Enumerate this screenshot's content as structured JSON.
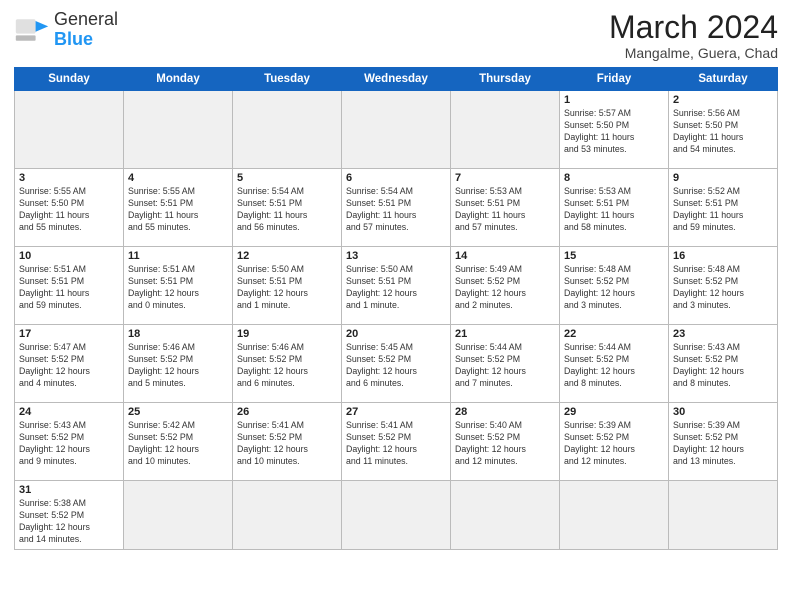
{
  "header": {
    "logo_general": "General",
    "logo_blue": "Blue",
    "month_title": "March 2024",
    "subtitle": "Mangalme, Guera, Chad"
  },
  "weekdays": [
    "Sunday",
    "Monday",
    "Tuesday",
    "Wednesday",
    "Thursday",
    "Friday",
    "Saturday"
  ],
  "weeks": [
    [
      {
        "day": "",
        "info": "",
        "empty": true
      },
      {
        "day": "",
        "info": "",
        "empty": true
      },
      {
        "day": "",
        "info": "",
        "empty": true
      },
      {
        "day": "",
        "info": "",
        "empty": true
      },
      {
        "day": "",
        "info": "",
        "empty": true
      },
      {
        "day": "1",
        "info": "Sunrise: 5:57 AM\nSunset: 5:50 PM\nDaylight: 11 hours\nand 53 minutes."
      },
      {
        "day": "2",
        "info": "Sunrise: 5:56 AM\nSunset: 5:50 PM\nDaylight: 11 hours\nand 54 minutes."
      }
    ],
    [
      {
        "day": "3",
        "info": "Sunrise: 5:55 AM\nSunset: 5:50 PM\nDaylight: 11 hours\nand 55 minutes."
      },
      {
        "day": "4",
        "info": "Sunrise: 5:55 AM\nSunset: 5:51 PM\nDaylight: 11 hours\nand 55 minutes."
      },
      {
        "day": "5",
        "info": "Sunrise: 5:54 AM\nSunset: 5:51 PM\nDaylight: 11 hours\nand 56 minutes."
      },
      {
        "day": "6",
        "info": "Sunrise: 5:54 AM\nSunset: 5:51 PM\nDaylight: 11 hours\nand 57 minutes."
      },
      {
        "day": "7",
        "info": "Sunrise: 5:53 AM\nSunset: 5:51 PM\nDaylight: 11 hours\nand 57 minutes."
      },
      {
        "day": "8",
        "info": "Sunrise: 5:53 AM\nSunset: 5:51 PM\nDaylight: 11 hours\nand 58 minutes."
      },
      {
        "day": "9",
        "info": "Sunrise: 5:52 AM\nSunset: 5:51 PM\nDaylight: 11 hours\nand 59 minutes."
      }
    ],
    [
      {
        "day": "10",
        "info": "Sunrise: 5:51 AM\nSunset: 5:51 PM\nDaylight: 11 hours\nand 59 minutes."
      },
      {
        "day": "11",
        "info": "Sunrise: 5:51 AM\nSunset: 5:51 PM\nDaylight: 12 hours\nand 0 minutes."
      },
      {
        "day": "12",
        "info": "Sunrise: 5:50 AM\nSunset: 5:51 PM\nDaylight: 12 hours\nand 1 minute."
      },
      {
        "day": "13",
        "info": "Sunrise: 5:50 AM\nSunset: 5:51 PM\nDaylight: 12 hours\nand 1 minute."
      },
      {
        "day": "14",
        "info": "Sunrise: 5:49 AM\nSunset: 5:52 PM\nDaylight: 12 hours\nand 2 minutes."
      },
      {
        "day": "15",
        "info": "Sunrise: 5:48 AM\nSunset: 5:52 PM\nDaylight: 12 hours\nand 3 minutes."
      },
      {
        "day": "16",
        "info": "Sunrise: 5:48 AM\nSunset: 5:52 PM\nDaylight: 12 hours\nand 3 minutes."
      }
    ],
    [
      {
        "day": "17",
        "info": "Sunrise: 5:47 AM\nSunset: 5:52 PM\nDaylight: 12 hours\nand 4 minutes."
      },
      {
        "day": "18",
        "info": "Sunrise: 5:46 AM\nSunset: 5:52 PM\nDaylight: 12 hours\nand 5 minutes."
      },
      {
        "day": "19",
        "info": "Sunrise: 5:46 AM\nSunset: 5:52 PM\nDaylight: 12 hours\nand 6 minutes."
      },
      {
        "day": "20",
        "info": "Sunrise: 5:45 AM\nSunset: 5:52 PM\nDaylight: 12 hours\nand 6 minutes."
      },
      {
        "day": "21",
        "info": "Sunrise: 5:44 AM\nSunset: 5:52 PM\nDaylight: 12 hours\nand 7 minutes."
      },
      {
        "day": "22",
        "info": "Sunrise: 5:44 AM\nSunset: 5:52 PM\nDaylight: 12 hours\nand 8 minutes."
      },
      {
        "day": "23",
        "info": "Sunrise: 5:43 AM\nSunset: 5:52 PM\nDaylight: 12 hours\nand 8 minutes."
      }
    ],
    [
      {
        "day": "24",
        "info": "Sunrise: 5:43 AM\nSunset: 5:52 PM\nDaylight: 12 hours\nand 9 minutes."
      },
      {
        "day": "25",
        "info": "Sunrise: 5:42 AM\nSunset: 5:52 PM\nDaylight: 12 hours\nand 10 minutes."
      },
      {
        "day": "26",
        "info": "Sunrise: 5:41 AM\nSunset: 5:52 PM\nDaylight: 12 hours\nand 10 minutes."
      },
      {
        "day": "27",
        "info": "Sunrise: 5:41 AM\nSunset: 5:52 PM\nDaylight: 12 hours\nand 11 minutes."
      },
      {
        "day": "28",
        "info": "Sunrise: 5:40 AM\nSunset: 5:52 PM\nDaylight: 12 hours\nand 12 minutes."
      },
      {
        "day": "29",
        "info": "Sunrise: 5:39 AM\nSunset: 5:52 PM\nDaylight: 12 hours\nand 12 minutes."
      },
      {
        "day": "30",
        "info": "Sunrise: 5:39 AM\nSunset: 5:52 PM\nDaylight: 12 hours\nand 13 minutes."
      }
    ],
    [
      {
        "day": "31",
        "info": "Sunrise: 5:38 AM\nSunset: 5:52 PM\nDaylight: 12 hours\nand 14 minutes."
      },
      {
        "day": "",
        "info": "",
        "empty": true
      },
      {
        "day": "",
        "info": "",
        "empty": true
      },
      {
        "day": "",
        "info": "",
        "empty": true
      },
      {
        "day": "",
        "info": "",
        "empty": true
      },
      {
        "day": "",
        "info": "",
        "empty": true
      },
      {
        "day": "",
        "info": "",
        "empty": true
      }
    ]
  ]
}
